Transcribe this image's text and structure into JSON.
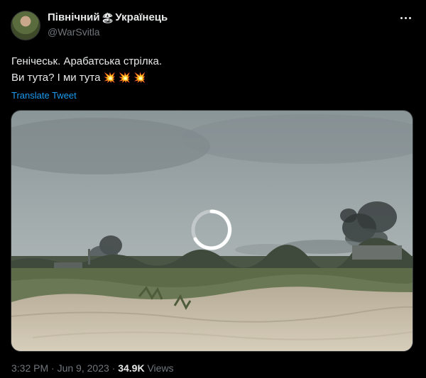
{
  "author": {
    "display_name": "Північний",
    "display_name_suffix": "Українець",
    "name_emoji": "🏖",
    "handle": "@WarSvitla"
  },
  "tweet": {
    "line1": "Генічеськ. Арабатська стрілка.",
    "line2": "Ви тута? І ми тута",
    "line2_emoji": "💥 💥 💥",
    "translate_label": "Translate Tweet"
  },
  "media": {
    "type": "video",
    "state": "loading"
  },
  "meta": {
    "time": "3:32 PM",
    "separator": "·",
    "date": "Jun 9, 2023",
    "views_count": "34.9K",
    "views_label": "Views"
  },
  "icons": {
    "more": "more-horizontal-icon",
    "spinner": "loading-spinner-icon"
  },
  "colors": {
    "background": "#000000",
    "text": "#e7e9ea",
    "muted": "#71767b",
    "link": "#1d9bf0"
  }
}
